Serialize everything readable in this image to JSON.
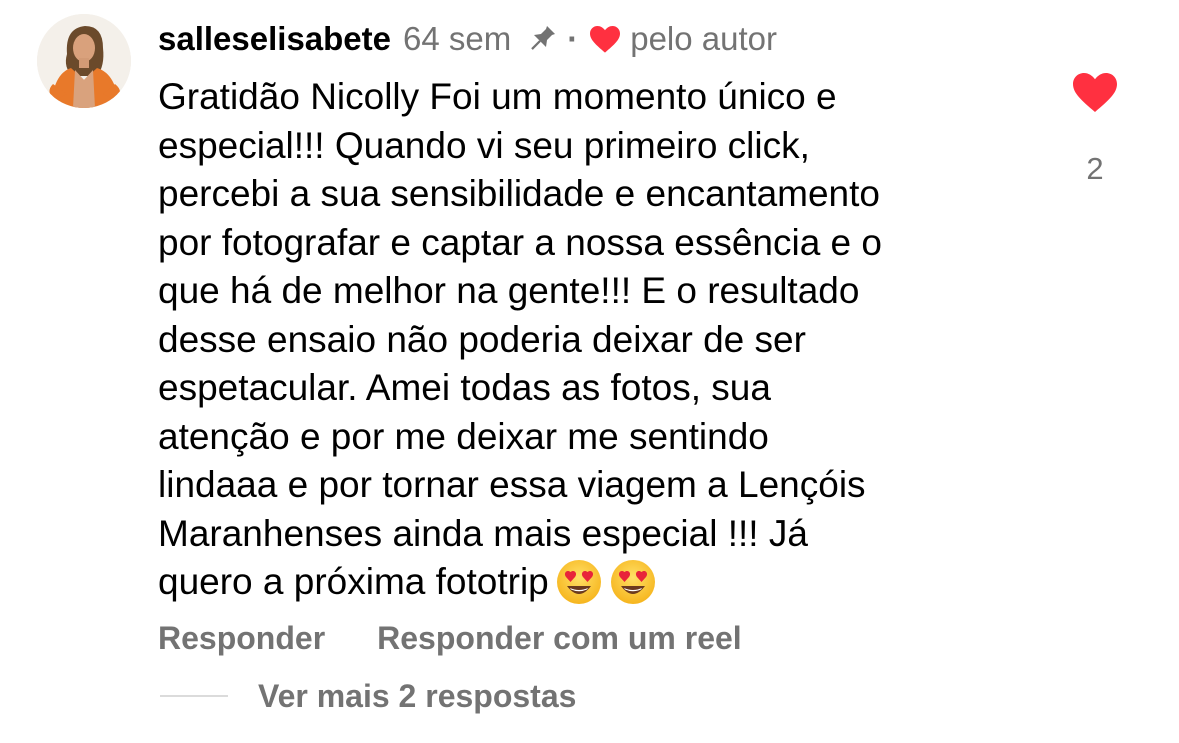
{
  "comment": {
    "username": "salleselisabete",
    "time": "64 sem",
    "separator": "·",
    "by_author": "pelo autor",
    "text_lines": [
      "Gratidão  Nicolly Foi um momento único e",
      "especial!!! Quando vi seu primeiro click,",
      "percebi a sua sensibilidade e encantamento",
      "por fotografar e captar a nossa essência e o",
      "que há de melhor na gente!!! E o resultado",
      "desse ensaio não poderia deixar de ser",
      "espetacular. Amei todas as fotos, sua",
      "atenção e por me deixar me sentindo",
      "lindaaa e por tornar essa viagem a Lençóis",
      "Maranhenses ainda mais especial !!! Já",
      "quero a próxima fototrip"
    ],
    "emojis": [
      "heart-eyes-emoji",
      "heart-eyes-emoji"
    ],
    "like_count": "2",
    "liked": true
  },
  "actions": {
    "reply_label": "Responder",
    "reply_reel_label": "Responder com um reel"
  },
  "replies": {
    "view_more_label": "Ver mais 2 respostas"
  },
  "icons": {
    "pin": "pin-icon",
    "author_heart": "heart-icon",
    "like": "heart-filled-icon"
  },
  "colors": {
    "heart_red": "#ff3040",
    "secondary_text": "#737373",
    "primary_text": "#000000",
    "divider": "#dbdbdb",
    "avatar_jacket": "#e8792a"
  }
}
